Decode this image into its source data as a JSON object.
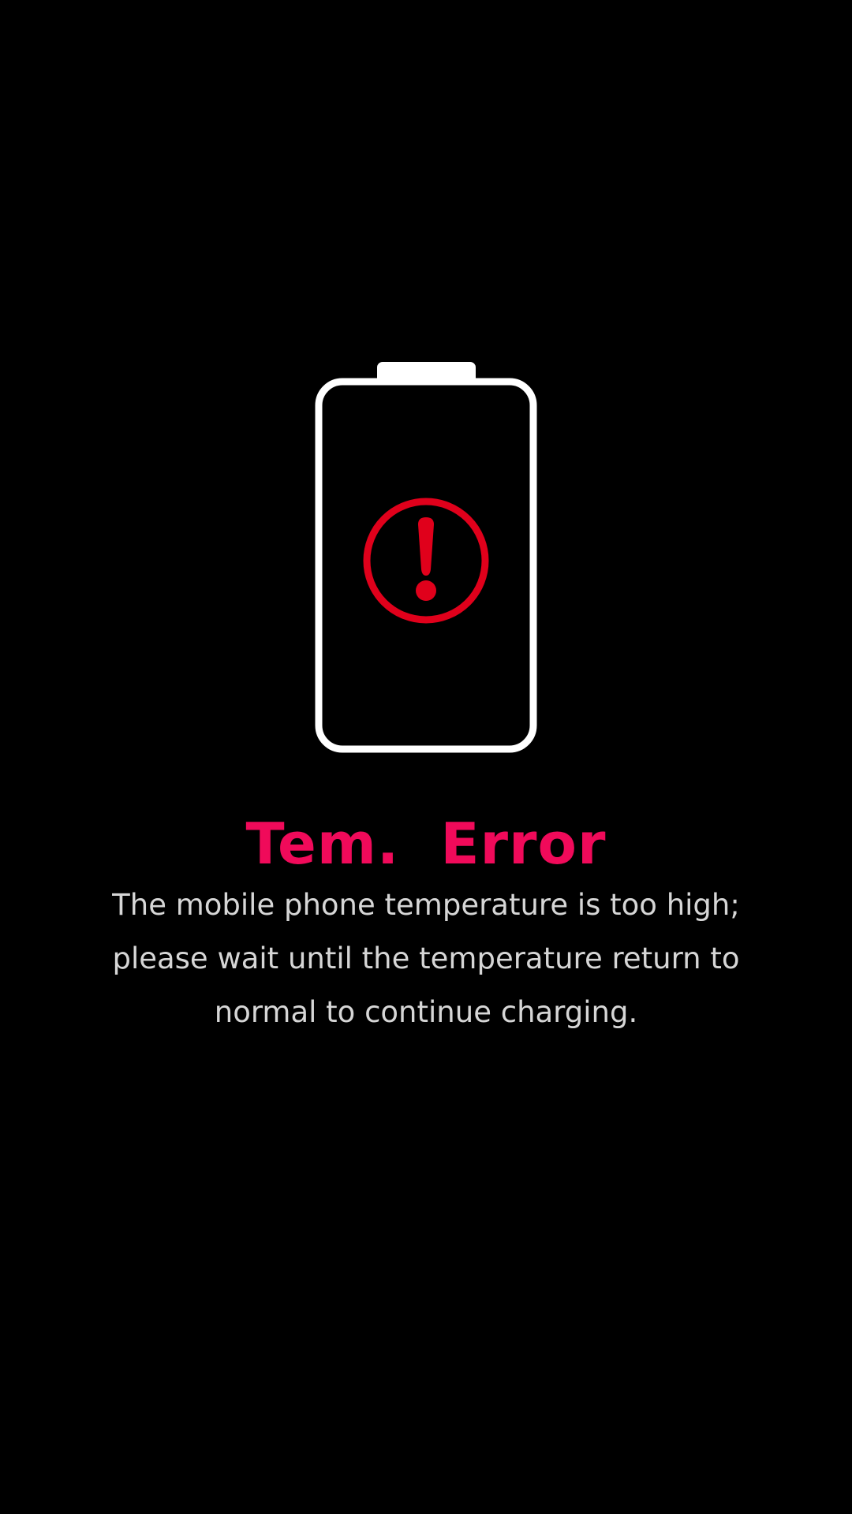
{
  "screen": {
    "title": "Tem.  Error",
    "message": "The mobile phone temperature is too high; please wait until the temperature return to normal to continue charging."
  },
  "icons": {
    "battery": "battery-outline-icon",
    "alert": "exclamation-circle-icon"
  },
  "colors": {
    "background": "#000000",
    "battery_outline": "#ffffff",
    "alert": "#e0001b",
    "title": "#f00a5a",
    "message": "#d6d6d6"
  }
}
